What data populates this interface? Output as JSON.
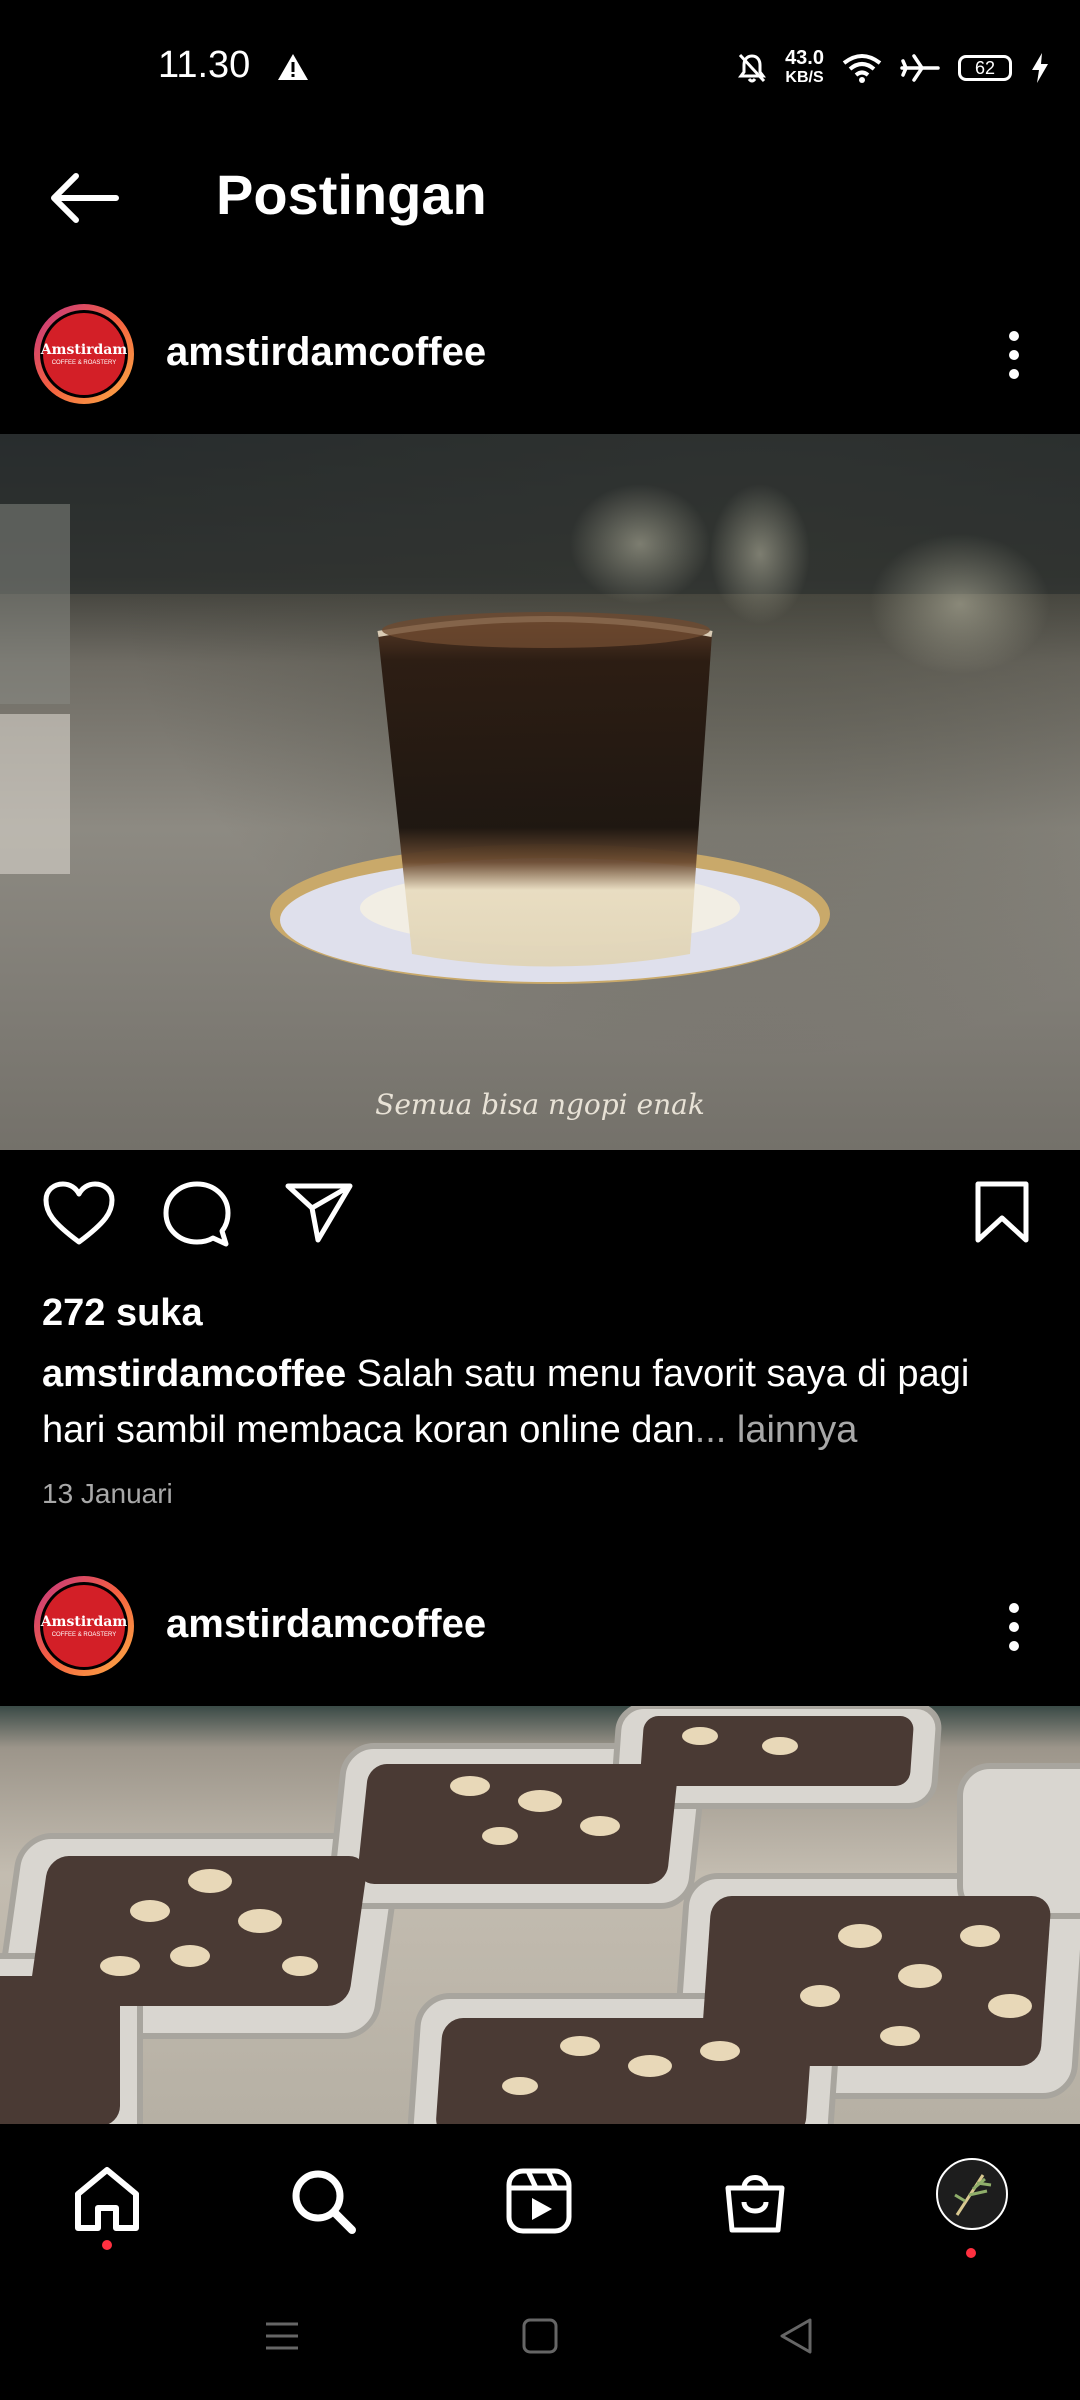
{
  "status_bar": {
    "time": "11.30",
    "net_speed": "43.0",
    "net_unit": "KB/S",
    "battery": "62",
    "icons": [
      "warning-icon",
      "mute-icon",
      "wifi-icon",
      "airplane-icon",
      "battery-icon",
      "charging-icon"
    ]
  },
  "header": {
    "title": "Postingan"
  },
  "posts": [
    {
      "username": "amstirdamcoffee",
      "avatar_brand": "Amstirdam",
      "avatar_tagline": "COFFEE & ROASTERY",
      "image_caption": "Semua bisa ngopi enak",
      "likes": "272 suka",
      "caption_user": "amstirdamcoffee",
      "caption_text": " Salah satu menu favorit saya di pagi hari sambil membaca koran online dan",
      "caption_more": "... lainnya",
      "date": "13 Januari"
    },
    {
      "username": "amstirdamcoffee",
      "avatar_brand": "Amstirdam",
      "avatar_tagline": "COFFEE & ROASTERY"
    }
  ],
  "colors": {
    "background": "#000000",
    "text": "#ffffff",
    "muted": "#a8a8a8",
    "notification_dot": "#ff3040",
    "brand_red": "#d31f27"
  }
}
